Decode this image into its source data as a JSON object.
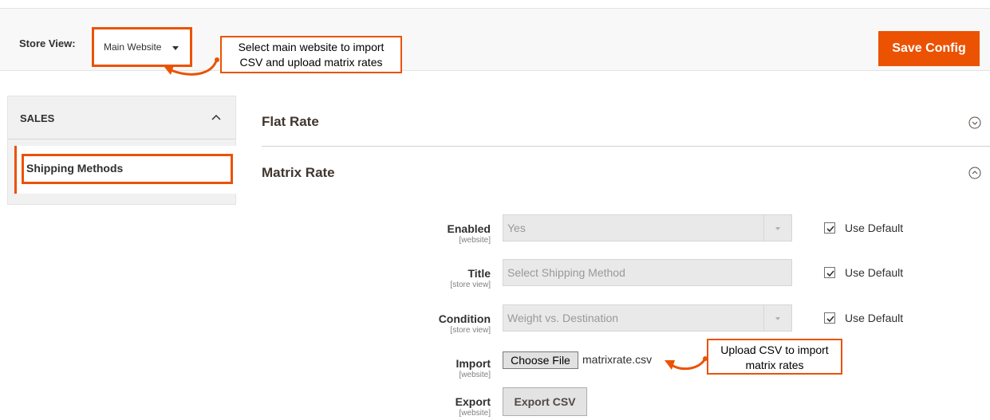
{
  "store_view": {
    "label": "Store View:",
    "selected": "Main Website",
    "save_button": "Save Config"
  },
  "annotations": {
    "store_note_line1": "Select main website to import",
    "store_note_line2": "CSV and upload matrix rates",
    "upload_note_line1": "Upload CSV to import",
    "upload_note_line2": "matrix rates"
  },
  "sidebar": {
    "group_title": "SALES",
    "items": [
      {
        "label": "Shipping Methods"
      }
    ]
  },
  "sections": {
    "flat_rate": "Flat Rate",
    "matrix_rate": "Matrix Rate"
  },
  "form": {
    "enabled": {
      "label": "Enabled",
      "scope": "[website]",
      "value": "Yes",
      "use_default": "Use Default"
    },
    "title": {
      "label": "Title",
      "scope": "[store view]",
      "value": "Select Shipping Method",
      "use_default": "Use Default"
    },
    "condition": {
      "label": "Condition",
      "scope": "[store view]",
      "value": "Weight vs. Destination",
      "use_default": "Use Default"
    },
    "import": {
      "label": "Import",
      "scope": "[website]",
      "button": "Choose File",
      "file_name": "matrixrate.csv"
    },
    "export": {
      "label": "Export",
      "scope": "[website]",
      "button": "Export CSV"
    }
  },
  "colors": {
    "accent": "#eb5202",
    "header_bg": "#f8f8f8",
    "sidebar_bg": "#f1f1f1",
    "disabled_field": "#e9e9e9"
  }
}
